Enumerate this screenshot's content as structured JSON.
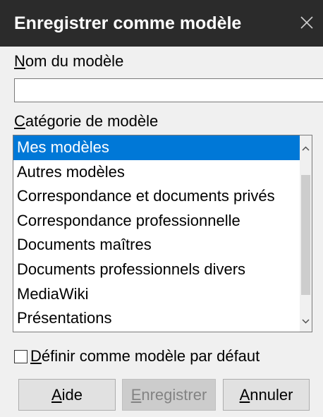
{
  "dialog": {
    "title": "Enregistrer comme modèle"
  },
  "name_field": {
    "label_mnemonic": "N",
    "label_rest": "om du modèle",
    "value": "",
    "placeholder": ""
  },
  "category": {
    "label_mnemonic": "C",
    "label_rest": "atégorie de modèle",
    "selected_index": 0,
    "items": [
      "Mes modèles",
      "Autres modèles",
      "Correspondance et documents privés",
      "Correspondance professionnelle",
      "Documents maîtres",
      "Documents professionnels divers",
      "MediaWiki",
      "Présentations"
    ]
  },
  "default_checkbox": {
    "label_mnemonic": "D",
    "label_rest": "éfinir comme modèle par défaut",
    "checked": false
  },
  "buttons": {
    "help_mnemonic": "A",
    "help_rest": "ide",
    "save_mnemonic": "E",
    "save_rest": "nregistrer",
    "save_enabled": false,
    "cancel_mnemonic": "A",
    "cancel_rest": "nnuler"
  },
  "colors": {
    "titlebar": "#2b2b2b",
    "selection": "#0078d7",
    "dialog_bg": "#f0f0f0"
  }
}
